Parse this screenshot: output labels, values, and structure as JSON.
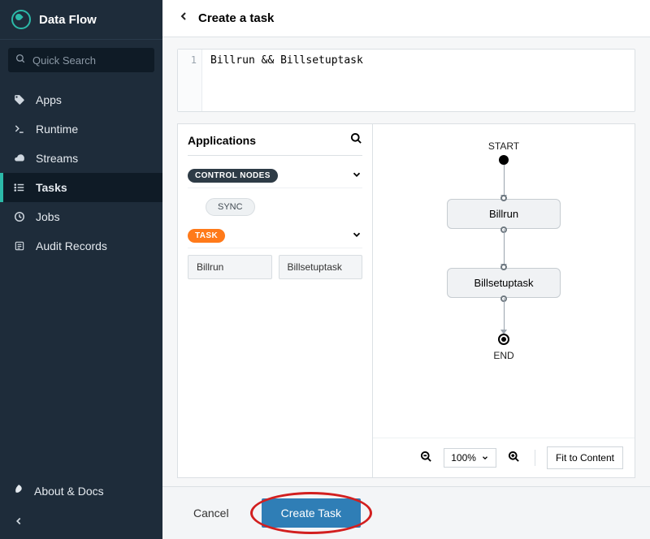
{
  "brand": {
    "title": "Data Flow"
  },
  "search": {
    "placeholder": "Quick Search"
  },
  "sidebar": {
    "items": [
      {
        "label": "Apps"
      },
      {
        "label": "Runtime"
      },
      {
        "label": "Streams"
      },
      {
        "label": "Tasks"
      },
      {
        "label": "Jobs"
      },
      {
        "label": "Audit Records"
      }
    ],
    "about": "About & Docs"
  },
  "header": {
    "title": "Create a task"
  },
  "editor": {
    "line_no": "1",
    "code": "Billrun && Billsetuptask"
  },
  "apps_panel": {
    "title": "Applications",
    "control_nodes_label": "CONTROL NODES",
    "sync_label": "SYNC",
    "task_label": "TASK",
    "tasks": [
      "Billrun",
      "Billsetuptask"
    ]
  },
  "flow": {
    "start": "START",
    "end": "END",
    "nodes": [
      "Billrun",
      "Billsetuptask"
    ]
  },
  "toolbar": {
    "zoom": "100%",
    "fit_label": "Fit to Content"
  },
  "footer": {
    "cancel": "Cancel",
    "create": "Create Task"
  }
}
